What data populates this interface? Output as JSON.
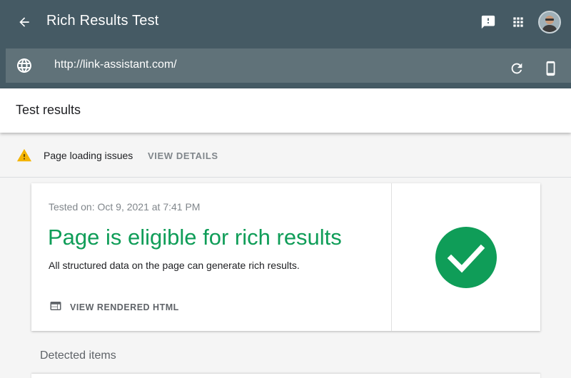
{
  "app": {
    "title": "Rich Results Test"
  },
  "urlbar": {
    "url": "http://link-assistant.com/"
  },
  "results": {
    "title": "Test results"
  },
  "issues": {
    "label": "Page loading issues",
    "action": "VIEW DETAILS"
  },
  "card": {
    "tested_on": "Tested on: Oct 9, 2021 at 7:41 PM",
    "headline": "Page is eligible for rich results",
    "subtext": "All structured data on the page can generate rich results.",
    "view_html": "VIEW RENDERED HTML"
  },
  "detected": {
    "label": "Detected items"
  },
  "icons": {
    "back": "arrow-back-icon",
    "feedback": "feedback-icon",
    "apps": "apps-grid-icon",
    "globe": "globe-icon",
    "refresh": "refresh-icon",
    "device": "smartphone-icon",
    "warning": "warning-icon",
    "html": "web-page-icon",
    "check": "check-circle-icon"
  },
  "colors": {
    "appbar": "#455a64",
    "urlbar": "#607279",
    "success": "#0f9d58",
    "warning": "#f4b400"
  }
}
